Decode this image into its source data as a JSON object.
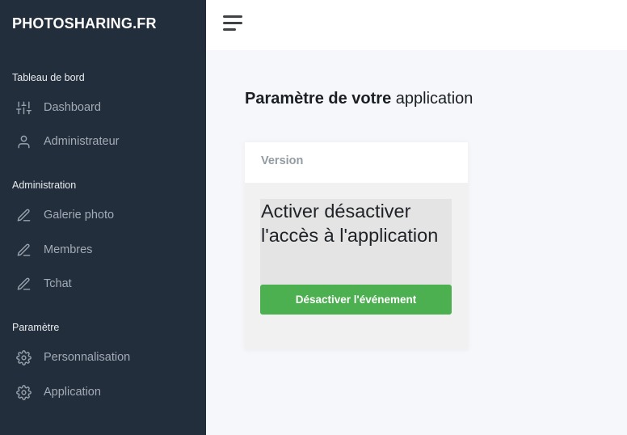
{
  "sidebar": {
    "brand": "PHOTOSHARING.FR",
    "sections": [
      {
        "header": "Tableau de bord",
        "items": [
          {
            "label": "Dashboard",
            "icon": "sliders-icon"
          },
          {
            "label": "Administrateur",
            "icon": "user-icon"
          }
        ]
      },
      {
        "header": "Administration",
        "items": [
          {
            "label": "Galerie photo",
            "icon": "pencil-icon"
          },
          {
            "label": "Membres",
            "icon": "pencil-icon"
          },
          {
            "label": "Tchat",
            "icon": "pencil-icon"
          }
        ]
      },
      {
        "header": "Paramètre",
        "items": [
          {
            "label": "Personnalisation",
            "icon": "gear-icon"
          },
          {
            "label": "Application",
            "icon": "gear-icon"
          }
        ]
      }
    ]
  },
  "topbar": {
    "menu_icon": "hamburger-menu-icon"
  },
  "main": {
    "title_bold": "Paramètre de votre",
    "title_regular": "application",
    "card": {
      "header": "Version",
      "toggle_text": "Activer désactiver l'accès à l'application",
      "button_label": "Désactiver l'événement"
    }
  },
  "colors": {
    "sidebar_bg": "#222e3c",
    "button_green": "#4caf50",
    "page_bg": "#f5f7fb"
  }
}
